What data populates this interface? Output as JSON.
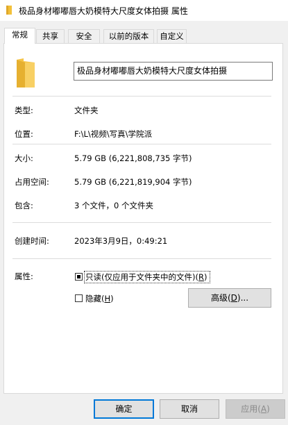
{
  "window": {
    "title": "极品身材嘟嘟唇大奶模特大尺度女体拍摄 属性",
    "folder_color": "#f3c13a"
  },
  "tabs": [
    {
      "label": "常规",
      "active": true
    },
    {
      "label": "共享",
      "active": false
    },
    {
      "label": "安全",
      "active": false
    },
    {
      "label": "以前的版本",
      "active": false
    },
    {
      "label": "自定义",
      "active": false
    }
  ],
  "general": {
    "folder_name": "极品身材嘟嘟唇大奶模特大尺度女体拍摄",
    "type": {
      "label": "类型:",
      "value": "文件夹"
    },
    "location": {
      "label": "位置:",
      "value": "F:\\L\\视频\\写真\\学院派"
    },
    "size": {
      "label": "大小:",
      "value": "5.79 GB (6,221,808,735 字节)"
    },
    "size_on_disk": {
      "label": "占用空间:",
      "value": "5.79 GB (6,221,819,904 字节)"
    },
    "contains": {
      "label": "包含:",
      "value": "3 个文件，0 个文件夹"
    },
    "created": {
      "label": "创建时间:",
      "value": "2023年3月9日，0:49:21"
    }
  },
  "attributes": {
    "label": "属性:",
    "readonly": {
      "text": "只读(仅应用于文件夹中的文件)(",
      "key": "R",
      "suffix": ")",
      "state": "indeterminate"
    },
    "hidden": {
      "text": "隐藏(",
      "key": "H",
      "suffix": ")",
      "checked": false
    },
    "advanced": {
      "text": "高级(",
      "key": "D",
      "suffix": ")..."
    }
  },
  "buttons": {
    "ok": "确定",
    "cancel": "取消",
    "apply_text": "应用(",
    "apply_key": "A",
    "apply_suffix": ")"
  }
}
